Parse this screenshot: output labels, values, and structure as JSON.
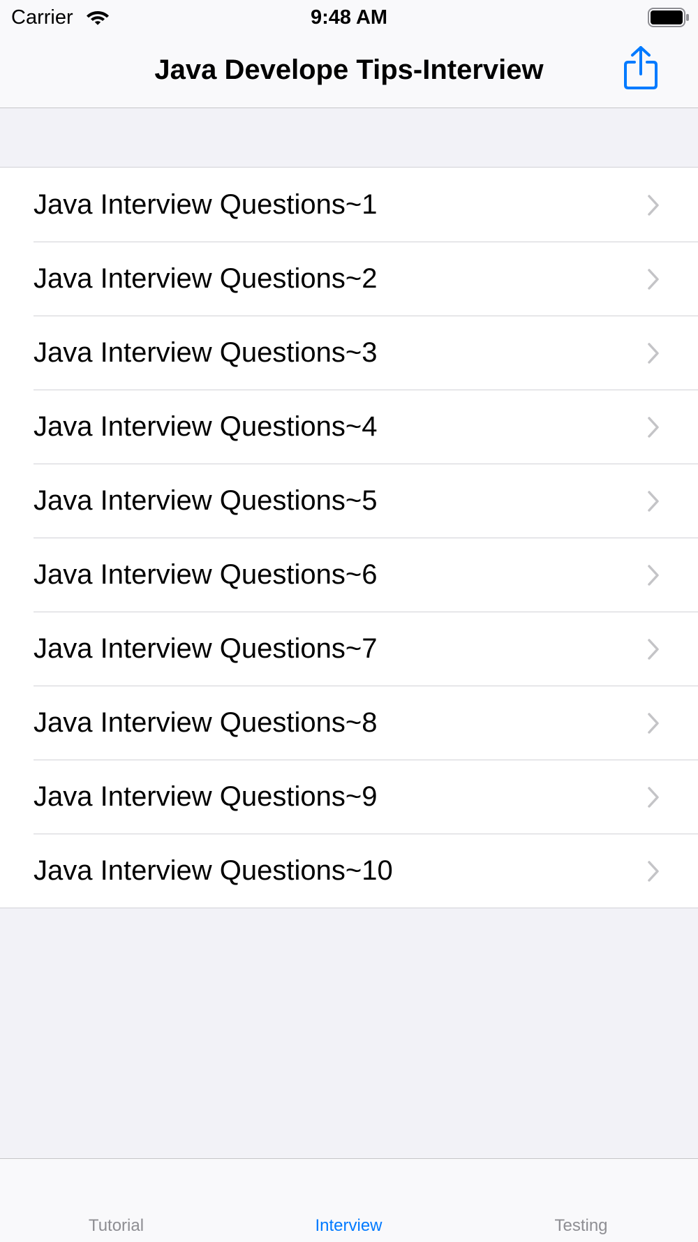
{
  "status_bar": {
    "carrier": "Carrier",
    "time": "9:48 AM"
  },
  "nav": {
    "title": "Java Develope Tips-Interview",
    "share_icon": "share-icon"
  },
  "list": {
    "items": [
      {
        "label": "Java Interview Questions~1"
      },
      {
        "label": "Java Interview Questions~2"
      },
      {
        "label": "Java Interview Questions~3"
      },
      {
        "label": "Java Interview Questions~4"
      },
      {
        "label": "Java Interview Questions~5"
      },
      {
        "label": "Java Interview Questions~6"
      },
      {
        "label": "Java Interview Questions~7"
      },
      {
        "label": "Java Interview Questions~8"
      },
      {
        "label": "Java Interview Questions~9"
      },
      {
        "label": "Java Interview Questions~10"
      }
    ]
  },
  "tabs": [
    {
      "label": "Tutorial",
      "active": false
    },
    {
      "label": "Interview",
      "active": true
    },
    {
      "label": "Testing",
      "active": false
    }
  ],
  "colors": {
    "accent": "#007aff",
    "inactive_tab": "#8e8e93",
    "background": "#f2f2f7"
  }
}
